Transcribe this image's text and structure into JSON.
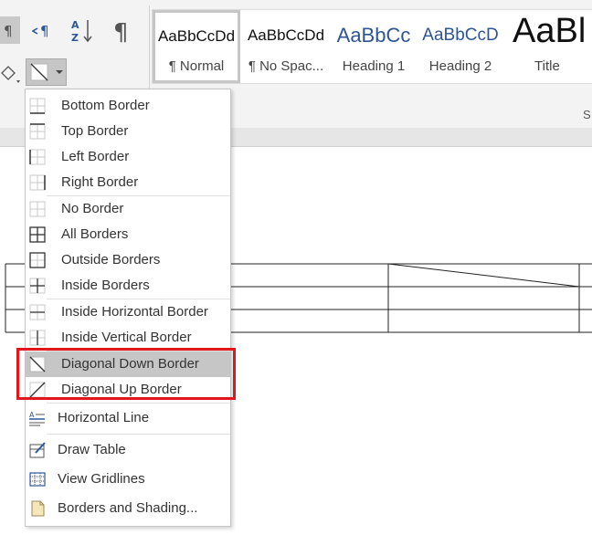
{
  "ribbon": {
    "styles": [
      {
        "preview": "AaBbCcDd",
        "name": "¶ Normal",
        "selected": true
      },
      {
        "preview": "AaBbCcDd",
        "name": "¶ No Spac..."
      },
      {
        "preview": "AaBbCc",
        "name": "Heading 1"
      },
      {
        "preview": "AaBbCcD",
        "name": "Heading 2"
      },
      {
        "preview": "AaBl",
        "name": "Title"
      }
    ],
    "group_label": "S"
  },
  "menu": {
    "items": [
      {
        "label": "Bottom Border"
      },
      {
        "label": "Top Border"
      },
      {
        "label": "Left Border"
      },
      {
        "label": "Right Border"
      },
      {
        "label": "No Border"
      },
      {
        "label": "All Borders"
      },
      {
        "label": "Outside Borders"
      },
      {
        "label": "Inside Borders"
      },
      {
        "label": "Inside Horizontal Border"
      },
      {
        "label": "Inside Vertical Border"
      },
      {
        "label": "Diagonal Down Border"
      },
      {
        "label": "Diagonal Up Border"
      },
      {
        "label": "Horizontal Line"
      },
      {
        "label": "Draw Table"
      },
      {
        "label": "View Gridlines"
      },
      {
        "label": "Borders and Shading..."
      }
    ]
  },
  "colors": {
    "highlight": "#c6c6c6",
    "callout": "#e3161d",
    "accent_blue": "#2b579a"
  }
}
